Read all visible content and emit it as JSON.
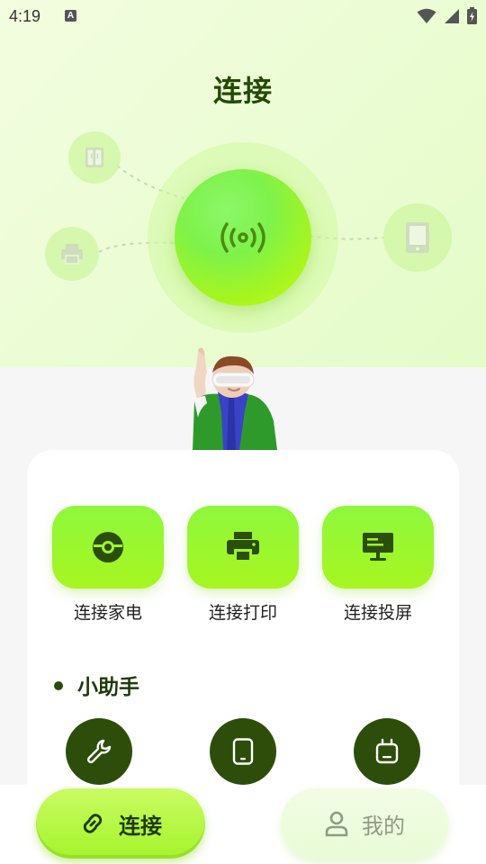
{
  "status_bar": {
    "time": "4:19",
    "notification_icon": "a-letter-icon",
    "icons": [
      "wifi-icon",
      "signal-icon",
      "battery-charging-icon"
    ]
  },
  "header": {
    "title": "连接"
  },
  "hero": {
    "hub_icon": "broadcast-icon",
    "satellites": [
      "fridge-icon",
      "printer-icon",
      "tablet-icon"
    ]
  },
  "quick_actions": [
    {
      "label": "连接家电",
      "icon": "appliance-icon"
    },
    {
      "label": "连接打印",
      "icon": "printer-icon"
    },
    {
      "label": "连接投屏",
      "icon": "screen-cast-icon"
    }
  ],
  "helper_section": {
    "title": "小助手",
    "items": [
      {
        "icon": "wrench-icon"
      },
      {
        "icon": "phone-icon"
      },
      {
        "icon": "tv-icon"
      }
    ]
  },
  "colors": {
    "accent": "#9ef52a",
    "dark_green": "#2d4e0a",
    "title": "#244a05"
  },
  "tabbar": {
    "tabs": [
      {
        "label": "连接",
        "icon": "link-icon",
        "active": true
      },
      {
        "label": "我的",
        "icon": "user-icon",
        "active": false
      }
    ]
  }
}
